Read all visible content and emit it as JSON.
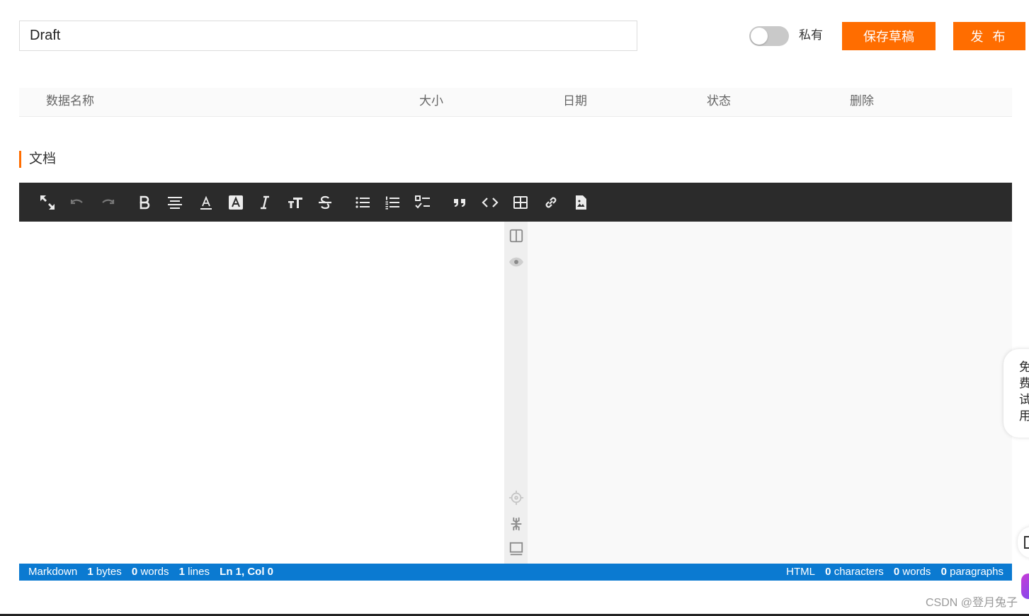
{
  "header": {
    "title_value": "Draft",
    "private_label": "私有",
    "save_label": "保存草稿",
    "publish_label": "发 布"
  },
  "table": {
    "columns": [
      "数据名称",
      "大小",
      "日期",
      "状态",
      "删除"
    ]
  },
  "section": {
    "title": "文档"
  },
  "toolbar": {
    "icons": [
      "fullscreen-icon",
      "undo-icon",
      "redo-icon",
      "bold-icon",
      "align-center-icon",
      "font-color-icon",
      "highlight-icon",
      "italic-icon",
      "font-size-icon",
      "strikethrough-icon",
      "bullet-list-icon",
      "numbered-list-icon",
      "task-list-icon",
      "quote-icon",
      "code-icon",
      "table-icon",
      "link-icon",
      "image-icon"
    ]
  },
  "gutter": {
    "icons": [
      "split-view-icon",
      "preview-eye-icon",
      "target-icon",
      "collapse-icon",
      "panel-icon"
    ]
  },
  "statusbar": {
    "left": {
      "mode": "Markdown",
      "bytes_count": "1",
      "bytes_label": "bytes",
      "words_count": "0",
      "words_label": "words",
      "lines_count": "1",
      "lines_label": "lines",
      "cursor": "Ln 1, Col 0"
    },
    "right": {
      "mode": "HTML",
      "chars_count": "0",
      "chars_label": "characters",
      "words_count": "0",
      "words_label": "words",
      "paragraphs_count": "0",
      "paragraphs_label": "paragraphs"
    }
  },
  "float_widget": {
    "text": "免费试用"
  },
  "watermark": "CSDN @登月兔子",
  "colors": {
    "accent": "#ff6d00",
    "toolbar_bg": "#2b2b2b",
    "statusbar_bg": "#0b7ad1"
  }
}
